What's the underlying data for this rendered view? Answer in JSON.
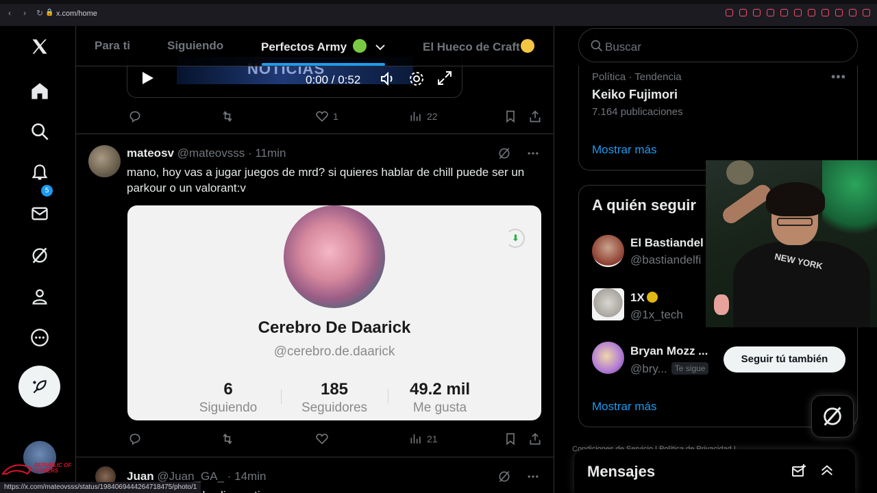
{
  "browser": {
    "url": "x.com/home",
    "status_url": "https://x.com/mateovsss/status/1984069444264718475/photo/1"
  },
  "leftnav": {
    "notification_count": "5",
    "rog_text": "REPUBLIC OF GAMERS"
  },
  "tabs": [
    {
      "label": "Para ti"
    },
    {
      "label": "Siguiendo"
    },
    {
      "label": "Perfectos Army"
    },
    {
      "label": "El Hueco de Craft"
    }
  ],
  "prev_tweet": {
    "video_overlay": "NOTICIAS",
    "video_time": "0:00 / 0:52",
    "likes": "1",
    "views": "22"
  },
  "tweet": {
    "name": "mateosv",
    "handle": "@mateovsss",
    "time": "· 11min",
    "text": "mano, hoy vas a jugar juegos de mrd? si quieres hablar de chill puede ser un parkour o un valorant:v",
    "media": {
      "profile_name": "Cerebro De Daarick",
      "profile_handle": "@cerebro.de.daarick",
      "stats": [
        {
          "num": "6",
          "label": "Siguiendo"
        },
        {
          "num": "185",
          "label": "Seguidores"
        },
        {
          "num": "49.2 mil",
          "label": "Me gusta"
        }
      ]
    },
    "views": "21"
  },
  "next_tweet": {
    "name": "Juan",
    "handle": "@Juan_GA_",
    "time": "· 14min",
    "text_partial": "ando clips antiguos :v"
  },
  "right": {
    "search_placeholder": "Buscar",
    "trend": {
      "meta": "Política · Tendencia",
      "name": "Keiko Fujimori",
      "count": "7.164 publicaciones"
    },
    "show_more": "Mostrar más",
    "who_to_follow": {
      "title": "A quién seguir",
      "users": [
        {
          "name": "El Bastiandel",
          "handle": "@bastiandelfi"
        },
        {
          "name": "1X",
          "handle": "@1x_tech"
        },
        {
          "name": "Bryan Mozz ...",
          "handle": "@bry...",
          "follows_you": "Te sigue"
        }
      ],
      "follow_button": "Seguir tú también",
      "show_more": "Mostrar más"
    },
    "footer": "Condiciones de Servicio  |  Política de Privacidad  |",
    "messages_title": "Mensajes"
  },
  "webcam": {
    "shirt_text": "NEW YORK"
  },
  "colors": {
    "accent": "#1d9bf0",
    "background": "#000000",
    "border": "#2f3336"
  }
}
